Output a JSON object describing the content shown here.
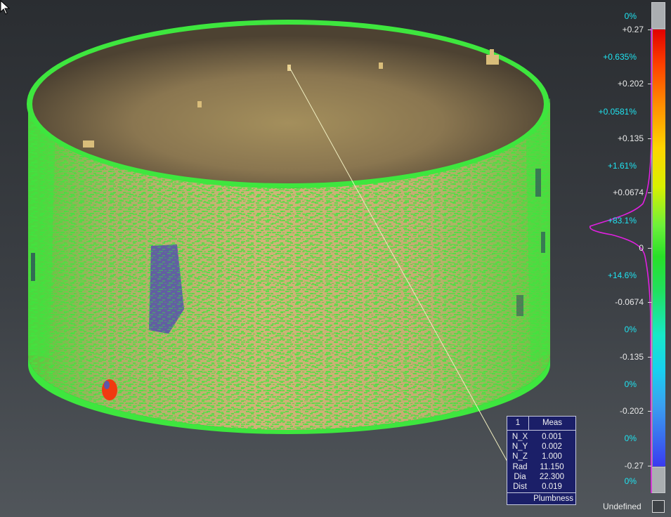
{
  "measurement": {
    "index": "1",
    "header": "Meas",
    "rows": [
      {
        "key": "N_X",
        "value": "0.001"
      },
      {
        "key": "N_Y",
        "value": "0.002"
      },
      {
        "key": "N_Z",
        "value": "1.000"
      },
      {
        "key": "Rad",
        "value": "11.150"
      },
      {
        "key": "Dia",
        "value": "22.300"
      },
      {
        "key": "Dist",
        "value": "0.019"
      }
    ],
    "footer": "Plumbness"
  },
  "colorbar": {
    "values": {
      "top_max": "+0.27",
      "v202": "+0.202",
      "v135": "+0.135",
      "v0674": "+0.0674",
      "zero": "0",
      "n0674": "-0.0674",
      "n135": "-0.135",
      "n202": "-0.202",
      "bottom_min": "-0.27"
    },
    "percents": {
      "above": "0%",
      "p1": "+0.635%",
      "p2": "+0.0581%",
      "p3": "+1.61%",
      "p4": "+83.1%",
      "p5": "+14.6%",
      "p6": "0%",
      "p7": "0%",
      "p8": "0%",
      "below": "0%"
    },
    "histogram_color": "#e020e0"
  },
  "undefined_label": "Undefined",
  "colors": {
    "deviation_green": "#3ee63e",
    "surface_tan": "#c9a86a",
    "measure_box": "#1b1f68",
    "cyan_text": "#1fe3f0"
  }
}
